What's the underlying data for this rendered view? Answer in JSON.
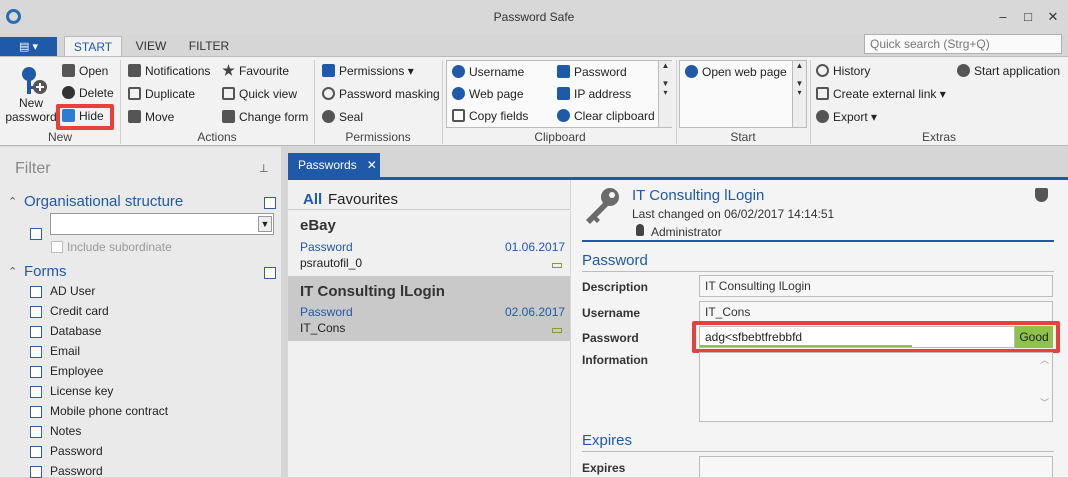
{
  "window": {
    "title": "Password Safe",
    "minimize": "–",
    "maximize": "□",
    "close": "✕"
  },
  "tabs": {
    "start": "START",
    "view": "VIEW",
    "filter": "FILTER"
  },
  "quick_search": {
    "placeholder": "Quick search (Strg+Q)"
  },
  "ribbon": {
    "new": {
      "new_password": "New password",
      "open": "Open",
      "delete": "Delete",
      "hide": "Hide",
      "group": "New"
    },
    "actions": {
      "notifications": "Notifications",
      "favourite": "Favourite",
      "duplicate": "Duplicate",
      "quick_view": "Quick view",
      "move": "Move",
      "change_form": "Change form",
      "group": "Actions"
    },
    "permissions": {
      "permissions": "Permissions",
      "password_masking": "Password masking",
      "seal": "Seal",
      "group": "Permissions"
    },
    "clipboard": {
      "username": "Username",
      "password": "Password",
      "web_page": "Web page",
      "ip_address": "IP address",
      "copy_fields": "Copy fields",
      "clear_clipboard": "Clear clipboard",
      "group": "Clipboard"
    },
    "start": {
      "open_web_page": "Open web page",
      "group": "Start"
    },
    "extras": {
      "history": "History",
      "start_application": "Start application",
      "create_external_link": "Create external link",
      "export": "Export",
      "group": "Extras"
    }
  },
  "filter_pane": {
    "title": "Filter",
    "org_structure": "Organisational structure",
    "include_subordinate": "Include subordinate",
    "forms_header": "Forms",
    "forms": [
      "AD User",
      "Credit card",
      "Database",
      "Email",
      "Employee",
      "License key",
      "Mobile phone contract",
      "Notes",
      "Password",
      "Password"
    ]
  },
  "passwords_tab": {
    "label": "Passwords",
    "close": "✕"
  },
  "list": {
    "all": "All",
    "favourites": "Favourites",
    "items": [
      {
        "title": "eBay",
        "form": "Password",
        "date": "01.06.2017",
        "user": "psrautofil_0"
      },
      {
        "title": "IT Consulting lLogin",
        "form": "Password",
        "date": "02.06.2017",
        "user": "IT_Cons"
      }
    ]
  },
  "detail": {
    "title": "IT Consulting lLogin",
    "last_changed": "Last changed on 06/02/2017 14:14:51",
    "owner": "Administrator",
    "section_password": "Password",
    "description_label": "Description",
    "description_value": "IT Consulting lLogin",
    "username_label": "Username",
    "username_value": "IT_Cons",
    "password_label": "Password",
    "password_value": "adg<sfbebtfrebbfd",
    "password_strength": "Good",
    "information_label": "Information",
    "section_expires": "Expires",
    "expires_label": "Expires"
  },
  "colors": {
    "accent": "#1e5aa8",
    "highlight": "#e8403a",
    "strength_good": "#8fc24a"
  }
}
